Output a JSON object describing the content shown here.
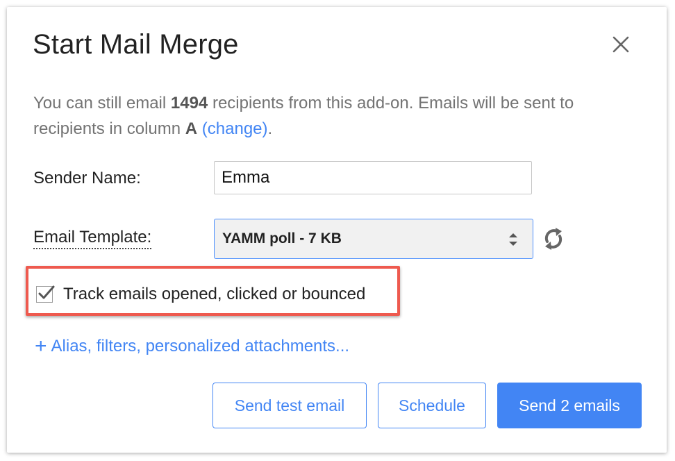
{
  "dialog": {
    "title": "Start Mail Merge",
    "close_icon": "close-icon"
  },
  "description": {
    "part1": "You can still email ",
    "count": "1494",
    "part2": " recipients from this add-on. Emails will be sent to recipients in column ",
    "column": "A",
    "space": " ",
    "change_link": "(change)",
    "period": "."
  },
  "sender": {
    "label": "Sender Name:",
    "value": "Emma"
  },
  "template": {
    "label": "Email Template:",
    "selected": "YAMM poll - 7 KB",
    "arrows_icon": "select-arrows-icon",
    "refresh_icon": "refresh-icon"
  },
  "tracking": {
    "checked": true,
    "label": "Track emails opened, clicked or bounced"
  },
  "more_options": {
    "plus": "+",
    "label": "Alias, filters, personalized attachments..."
  },
  "buttons": {
    "test": "Send test email",
    "schedule": "Schedule",
    "send": "Send 2 emails"
  },
  "colors": {
    "accent": "#4285f4",
    "highlight": "#ee5a4f",
    "muted_text": "#737373"
  }
}
